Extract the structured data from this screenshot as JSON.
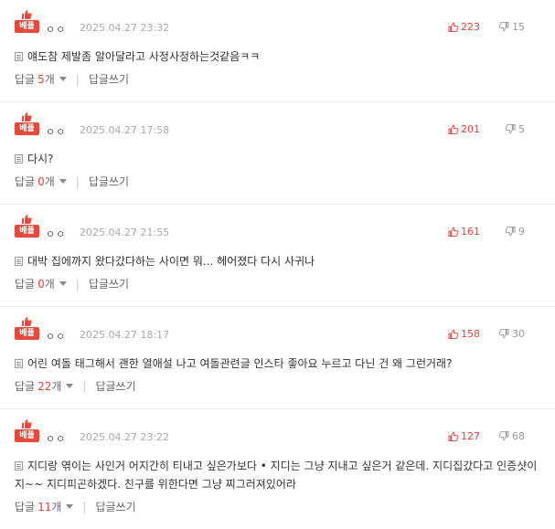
{
  "badge_label": "베플",
  "reply_label": "답글",
  "reply_unit": "개",
  "write_reply_label": "답글쓰기",
  "comments": [
    {
      "nick": "ㅇㅇ",
      "date": "2025.04.27 23:32",
      "up": "223",
      "down": "15",
      "text": "얘도참 제발좀 알아달라고 사정사정하는것같음ㅋㅋ",
      "replies": "5"
    },
    {
      "nick": "ㅇㅇ",
      "date": "2025.04.27 17:58",
      "up": "201",
      "down": "5",
      "text": "다시?",
      "replies": "0"
    },
    {
      "nick": "ㅇㅇ",
      "date": "2025.04.27 21:55",
      "up": "161",
      "down": "9",
      "text": "대박 집에까지 왔다갔다하는 사이면 뭐... 헤어졌다 다시 사귀나",
      "replies": "0"
    },
    {
      "nick": "ㅇㅇ",
      "date": "2025.04.27 18:17",
      "up": "158",
      "down": "30",
      "text": "어린 여돌 태그해서 괜한 열애설 나고 여돌관련글 인스타 좋아요 누르고 다닌 건 왜 그런거래?",
      "replies": "22"
    },
    {
      "nick": "ㅇㅇ",
      "date": "2025.04.27 23:22",
      "up": "127",
      "down": "68",
      "text": "지디랑 엮이는 사인거 어지간히 티내고 싶은가보다 •  지디는 그냥 지내고 싶은거 같은데. 지디집갔다고 인증샷이지~~ 지디피곤하겠다. 친구를 위한다면 그냥 찌그러져있어라",
      "replies": "11"
    }
  ]
}
